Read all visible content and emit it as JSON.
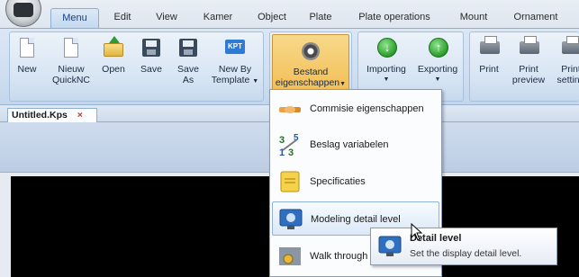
{
  "tabs": [
    {
      "label": "Menu",
      "active": true
    },
    {
      "label": "Edit"
    },
    {
      "label": "View"
    },
    {
      "label": "Kamer"
    },
    {
      "label": "Object"
    },
    {
      "label": "Plate"
    },
    {
      "label": "Plate operations"
    },
    {
      "label": "Mount"
    },
    {
      "label": "Ornament"
    }
  ],
  "ribbon": {
    "buttons": [
      {
        "label1": "New",
        "label2": "",
        "icon": "new-document-icon"
      },
      {
        "label1": "Nieuw",
        "label2": "QuickNC",
        "icon": "new-quicknc-icon"
      },
      {
        "label1": "Open",
        "label2": "",
        "icon": "open-folder-icon"
      },
      {
        "label1": "Save",
        "label2": "",
        "icon": "save-disk-icon"
      },
      {
        "label1": "Save",
        "label2": "As",
        "icon": "save-as-icon"
      },
      {
        "label1": "New By",
        "label2": "Template",
        "icon": "kpt-template-icon"
      },
      {
        "label1": "Bestand",
        "label2": "eigenschappen",
        "icon": "settings-gear-icon"
      },
      {
        "label1": "Importing",
        "label2": "",
        "icon": "import-arrow-icon"
      },
      {
        "label1": "Exporting",
        "label2": "",
        "icon": "export-arrow-icon"
      },
      {
        "label1": "Print",
        "label2": "",
        "icon": "printer-icon"
      },
      {
        "label1": "Print",
        "label2": "preview",
        "icon": "print-preview-icon"
      },
      {
        "label1": "Print",
        "label2": "setting",
        "icon": "print-settings-icon"
      }
    ],
    "kpt_icon_text": "KPT"
  },
  "document_tab": {
    "label": "Untitled.Kps",
    "close": "×"
  },
  "dropdown": {
    "items": [
      {
        "label": "Commisie eigenschappen",
        "icon": "handshake-icon"
      },
      {
        "label": "Beslag variabelen",
        "icon": "numbers-icon"
      },
      {
        "label": "Specificaties",
        "icon": "note-icon"
      },
      {
        "label": "Modeling detail level",
        "icon": "monitor-gear-icon",
        "highlighted": true
      },
      {
        "label": "Walk through",
        "icon": "walk-through-icon"
      }
    ],
    "numbers_icon_text": [
      "3",
      "5",
      "1",
      "3"
    ]
  },
  "tooltip": {
    "title": "Detail level",
    "description": "Set the display detail level."
  }
}
